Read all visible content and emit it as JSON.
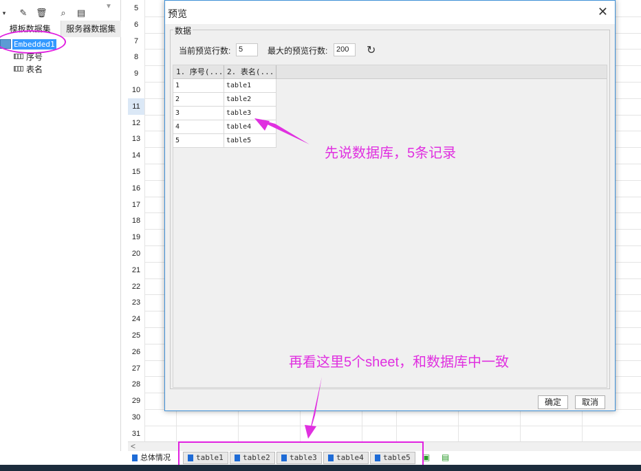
{
  "left_panel": {
    "tabs": [
      "模板数据集",
      "服务器数据集"
    ],
    "tree": {
      "root": "Embedded1",
      "children": [
        "序号",
        "表名"
      ]
    }
  },
  "sheet": {
    "row_numbers": [
      "5",
      "6",
      "7",
      "8",
      "9",
      "10",
      "11",
      "12",
      "13",
      "14",
      "15",
      "16",
      "17",
      "18",
      "19",
      "20",
      "21",
      "22",
      "23",
      "24",
      "25",
      "26",
      "27",
      "28",
      "29",
      "30",
      "31"
    ],
    "current_row": "11"
  },
  "bottom_tabs": {
    "summary": "总体情况",
    "tables": [
      "table1",
      "table2",
      "table3",
      "table4",
      "table5"
    ]
  },
  "dialog": {
    "title": "预览",
    "group_label": "数据",
    "current_rows_label": "当前预览行数:",
    "current_rows_value": "5",
    "max_rows_label": "最大的预览行数:",
    "max_rows_value": "200",
    "columns": [
      "1. 序号(...",
      "2. 表名(..."
    ],
    "rows": [
      [
        "1",
        "table1"
      ],
      [
        "2",
        "table2"
      ],
      [
        "3",
        "table3"
      ],
      [
        "4",
        "table4"
      ],
      [
        "5",
        "table5"
      ]
    ],
    "ok_label": "确定",
    "cancel_label": "取消"
  },
  "annotations": {
    "first": "先说数据库，5条记录",
    "second": "再看这里5个sheet，和数据库中一致"
  },
  "colors": {
    "annotation": "#e030e0",
    "selection": "#3399ff",
    "dialog_border": "#3d8fd6"
  }
}
